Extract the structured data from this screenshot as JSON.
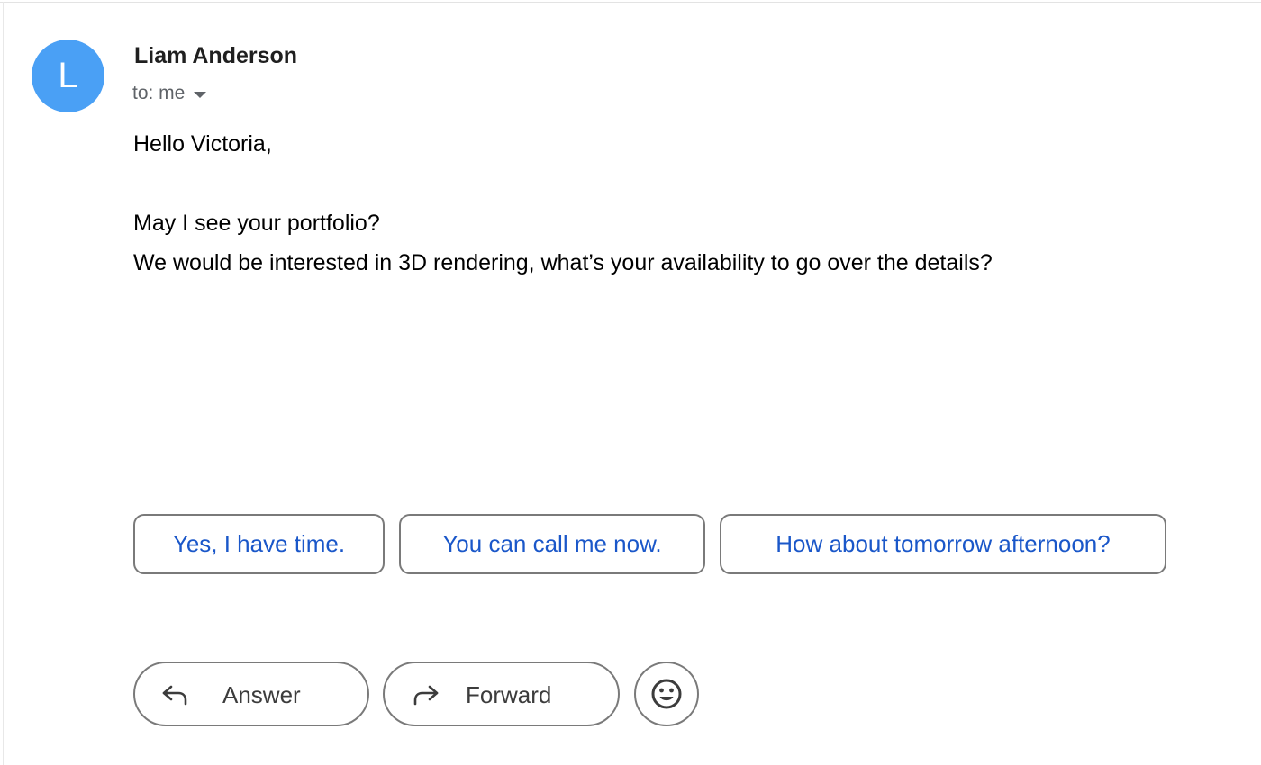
{
  "message": {
    "avatar_letter": "L",
    "avatar_color": "#4aa0f5",
    "sender_name": "Liam Anderson",
    "recipient_label": "to: me",
    "body": {
      "greeting": "Hello Victoria,",
      "lines": [
        "May I see your portfolio?",
        "We would be interested in 3D rendering, what’s your availability to go over the details?"
      ]
    }
  },
  "smart_replies": [
    "Yes, I have time.",
    "You can call me now.",
    "How about tomorrow afternoon?"
  ],
  "actions": {
    "answer_label": "Answer",
    "answer_icon": "reply-icon",
    "forward_label": "Forward",
    "forward_icon": "forward-icon",
    "emoji_icon": "emoji-icon"
  },
  "colors": {
    "link_blue": "#1a57c9",
    "border_gray": "#7a7a7a"
  }
}
